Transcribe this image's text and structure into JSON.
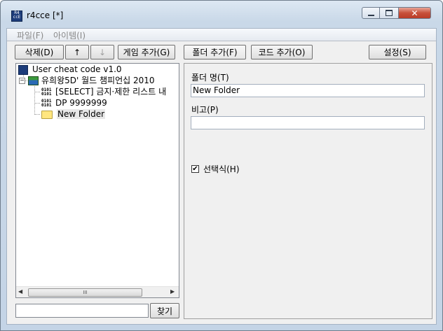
{
  "window": {
    "title": "r4cce [*]",
    "app_icon_text": "R4 ccE"
  },
  "menu": {
    "file": "파일(F)",
    "item": "아이템(I)"
  },
  "toolbar": {
    "delete": "삭제(D)",
    "up": "↑",
    "down": "↓",
    "add_game": "게임 추가(G)",
    "add_folder": "폴더 추가(F)",
    "add_code": "코드 추가(O)",
    "settings": "설정(S)"
  },
  "tree": {
    "root": "User cheat code v1.0",
    "game": "유희왕5D' 월드 챔피언십 2010",
    "items": [
      {
        "label": "[SELECT] 금지·제한 리스트 내",
        "icon": "code-icon"
      },
      {
        "label": "DP 9999999",
        "icon": "code-icon"
      },
      {
        "label": "New Folder",
        "icon": "folder-icon"
      }
    ],
    "code_icon_text": "0101 0101"
  },
  "search": {
    "value": "",
    "find_label": "찾기",
    "scroll_grip": "III"
  },
  "panel": {
    "folder_name_label": "폴더 명(T)",
    "folder_name_value": "New Folder",
    "note_label": "비고(P)",
    "note_value": "",
    "selectable_label": "선택식(H)",
    "selectable_checked": true,
    "check_glyph": "✔"
  },
  "colors": {
    "titlebar": "#c9d8e8",
    "close": "#c8503a",
    "folder": "#ffe680",
    "selection": "#e8e8e8"
  }
}
